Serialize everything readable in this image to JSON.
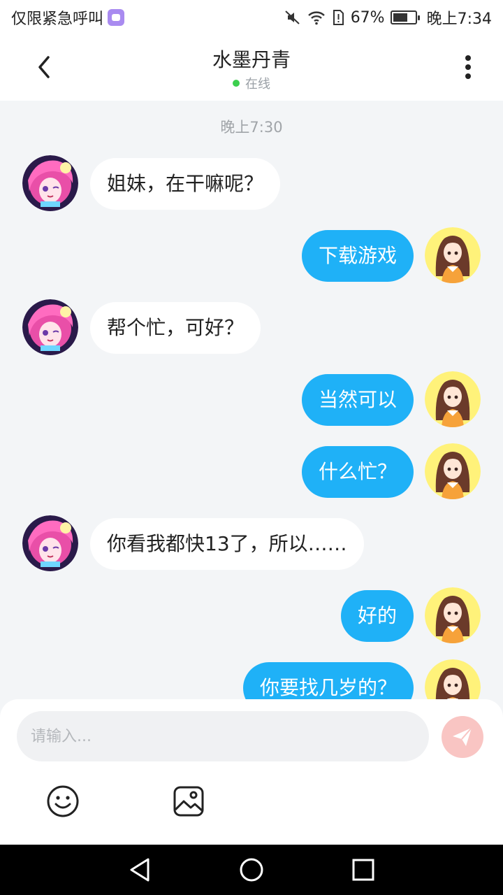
{
  "status_bar": {
    "emergency_text": "仅限紧急呼叫",
    "battery_percent": "67%",
    "battery_level": 0.67,
    "time": "晚上7:34",
    "icons": [
      "app-badge-icon",
      "mute-icon",
      "wifi-icon",
      "sim-alert-icon",
      "battery-icon"
    ]
  },
  "header": {
    "title": "水墨丹青",
    "status": "在线",
    "status_color": "#3ccf4e"
  },
  "chat": {
    "time_label": "晚上7:30",
    "messages": [
      {
        "side": "left",
        "text": "姐妹，在干嘛呢？"
      },
      {
        "side": "right",
        "text": "下载游戏"
      },
      {
        "side": "left",
        "text": "帮个忙，可好？"
      },
      {
        "side": "right",
        "text": "当然可以"
      },
      {
        "side": "right",
        "text": "什么忙？"
      },
      {
        "side": "left",
        "text": "你看我都快13了，所以……"
      },
      {
        "side": "right",
        "text": "好的"
      },
      {
        "side": "right",
        "text": "你要找几岁的？"
      }
    ]
  },
  "composer": {
    "placeholder": "请输入...",
    "send_color": "#f9c5c3"
  },
  "colors": {
    "accent": "#1fb1f7",
    "background": "#f3f5f7"
  }
}
